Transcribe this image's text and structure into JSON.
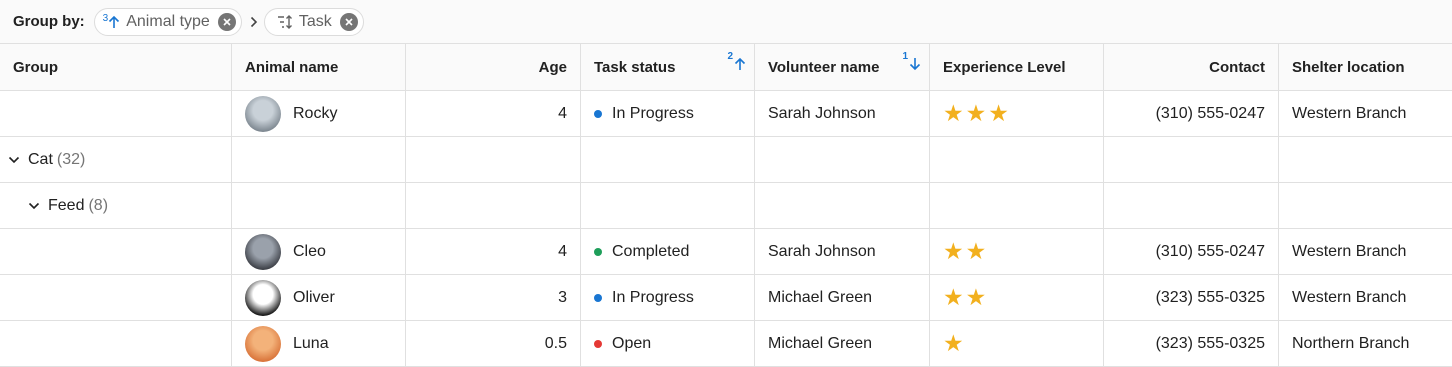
{
  "group_by": {
    "label": "Group by:",
    "chips": [
      {
        "sort_order": "3",
        "sort_dir": "asc",
        "text": "Animal type"
      },
      {
        "text": "Task"
      }
    ]
  },
  "columns": [
    {
      "label": "Group"
    },
    {
      "label": "Animal name"
    },
    {
      "label": "Age"
    },
    {
      "label": "Task status",
      "sort_order": "2",
      "sort_dir": "asc"
    },
    {
      "label": "Volunteer name",
      "sort_order": "1",
      "sort_dir": "desc"
    },
    {
      "label": "Experience Level"
    },
    {
      "label": "Contact"
    },
    {
      "label": "Shelter location"
    }
  ],
  "rows": [
    {
      "type": "data",
      "name": "Rocky",
      "age": "4",
      "status": "In Progress",
      "status_color": "#1976d2",
      "volunteer": "Sarah Johnson",
      "stars": 3,
      "contact": "(310) 555-0247",
      "location": "Western Branch",
      "avatar": [
        "#c9d1d8",
        "#7d8790"
      ]
    },
    {
      "type": "group",
      "level": 0,
      "label": "Cat",
      "count": "(32)"
    },
    {
      "type": "group",
      "level": 1,
      "label": "Feed",
      "count": "(8)"
    },
    {
      "type": "data",
      "name": "Cleo",
      "age": "4",
      "status": "Completed",
      "status_color": "#1e9e5a",
      "volunteer": "Sarah Johnson",
      "stars": 2,
      "contact": "(310) 555-0247",
      "location": "Western Branch",
      "avatar": [
        "#9aa1ab",
        "#3c3f46"
      ]
    },
    {
      "type": "data",
      "name": "Oliver",
      "age": "3",
      "status": "In Progress",
      "status_color": "#1976d2",
      "volunteer": "Michael Green",
      "stars": 2,
      "contact": "(323) 555-0325",
      "location": "Western Branch",
      "avatar": [
        "#ffffff",
        "#141414"
      ]
    },
    {
      "type": "data",
      "name": "Luna",
      "age": "0.5",
      "status": "Open",
      "status_color": "#e53935",
      "volunteer": "Michael Green",
      "stars": 1,
      "contact": "(323) 555-0325",
      "location": "Northern Branch",
      "avatar": [
        "#f3b27a",
        "#d9743a"
      ]
    }
  ],
  "icons": {
    "sort": "arrow-icon",
    "remove": "close-icon",
    "separator": "chevron-right-icon",
    "expand": "chevron-down-icon",
    "rating": "star-icon"
  }
}
